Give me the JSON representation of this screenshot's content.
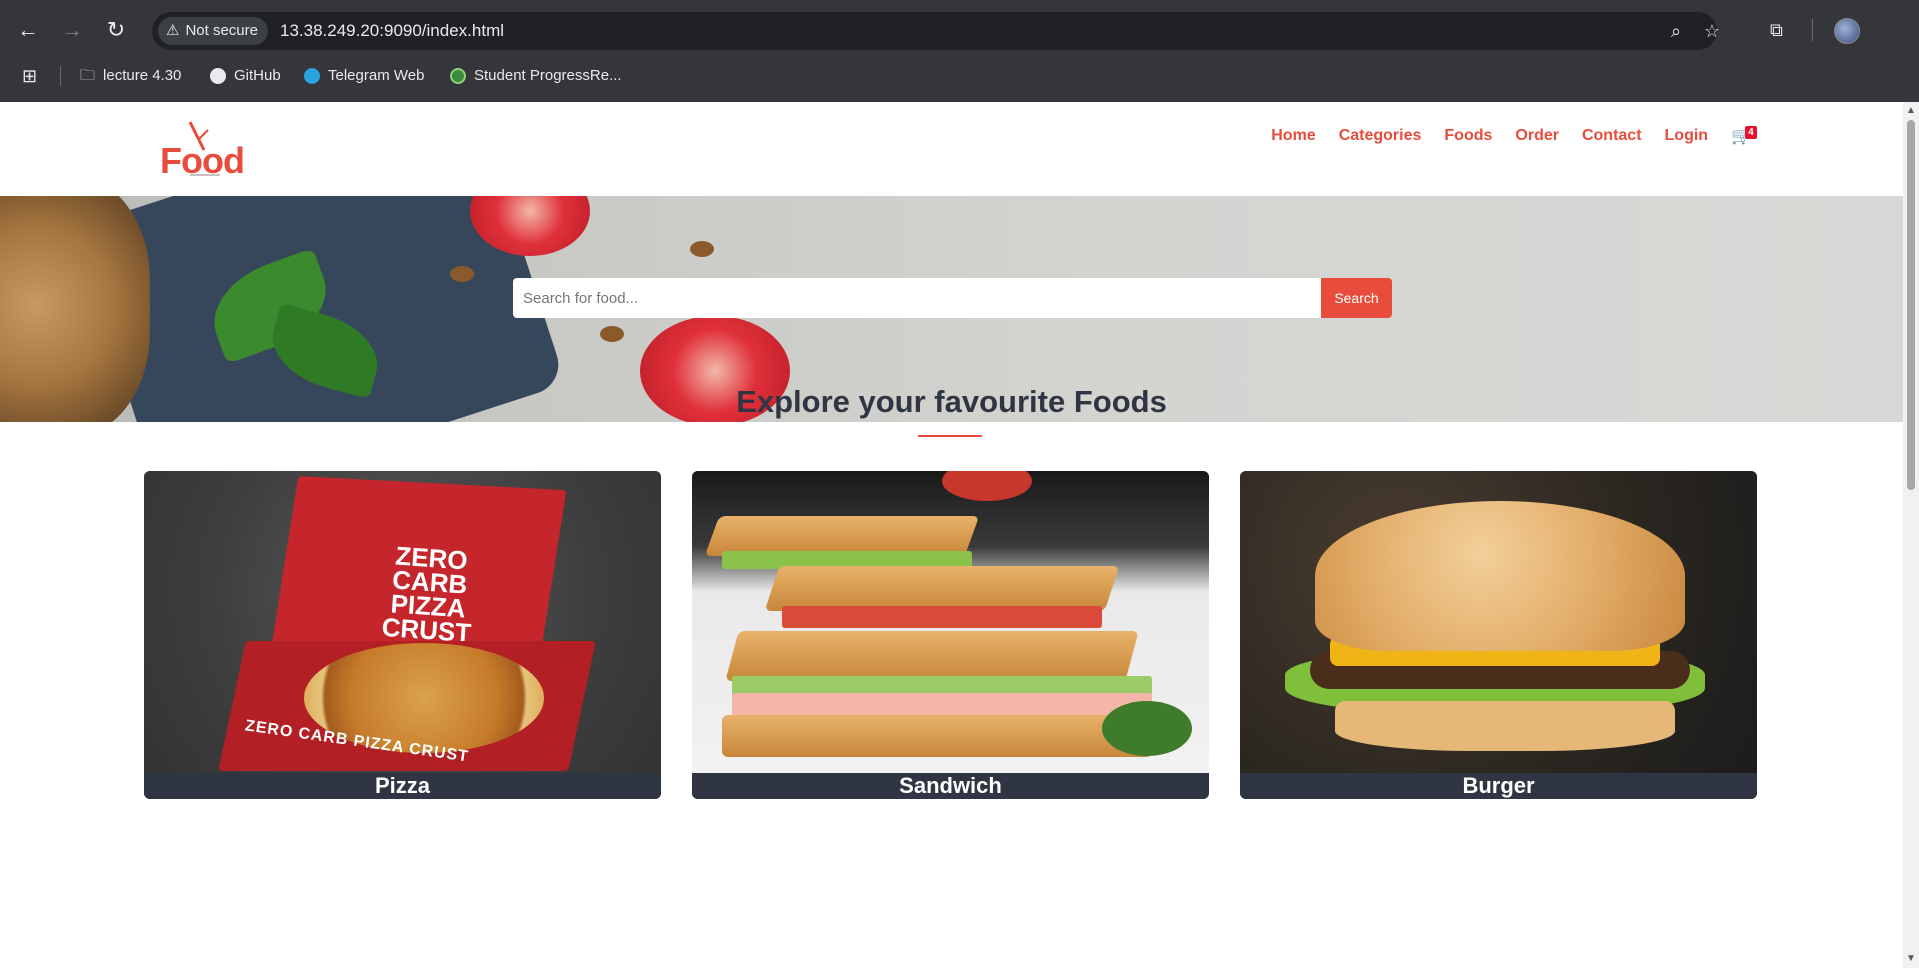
{
  "browser": {
    "security_label": "Not secure",
    "url": "13.38.249.20:9090/index.html",
    "bookmarks": [
      {
        "label": "lecture 4.30",
        "icon": "folder-icon"
      },
      {
        "label": "GitHub",
        "icon": "github-icon"
      },
      {
        "label": "Telegram Web",
        "icon": "telegram-icon"
      },
      {
        "label": "Student ProgressRe...",
        "icon": "site-favicon-icon"
      }
    ]
  },
  "site": {
    "logo_text": "Food",
    "menu": [
      {
        "label": "Home"
      },
      {
        "label": "Categories"
      },
      {
        "label": "Foods"
      },
      {
        "label": "Order"
      },
      {
        "label": "Contact"
      },
      {
        "label": "Login"
      }
    ],
    "cart_count": "4"
  },
  "search": {
    "placeholder": "Search for food...",
    "button_label": "Search"
  },
  "section": {
    "title": "Explore your favourite Foods"
  },
  "categories": [
    {
      "label": "Pizza",
      "box_text": "ZERO CARB PIZZA CRUST",
      "box_front": "ZERO CARB PIZZA CRUST"
    },
    {
      "label": "Sandwich"
    },
    {
      "label": "Burger"
    }
  ],
  "colors": {
    "accent": "#e74c3c",
    "dark": "#2f3542",
    "chrome": "#35363a"
  }
}
